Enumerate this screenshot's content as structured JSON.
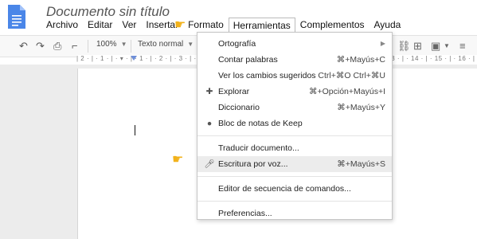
{
  "header": {
    "title": "Documento sin título",
    "menus": [
      "Archivo",
      "Editar",
      "Ver",
      "Insertar",
      "Formato",
      "Herramientas",
      "Complementos",
      "Ayuda"
    ]
  },
  "toolbar": {
    "zoom": "100%",
    "style": "Texto normal"
  },
  "ruler": {
    "text": "| 2 · | · 1 · | · ▾ · | · 1 · | · 2 · | · 3 · | · 4 · | · 5 · | · 6 · | · 7 · | · 8 · | · 9 · | · 10 · | · 11 · | · 12 · | · 13 · | · 14 · | · 15 · | · 16 · | · 17"
  },
  "menu": {
    "items": [
      {
        "label": "Ortografía",
        "shortcut": "",
        "submenu": true
      },
      {
        "label": "Contar palabras",
        "shortcut": "⌘+Mayús+C"
      },
      {
        "label": "Ver los cambios sugeridos",
        "shortcut": "Ctrl+⌘O Ctrl+⌘U"
      },
      {
        "label": "Explorar",
        "shortcut": "⌘+Opción+Mayús+I",
        "icon": "explore-icon"
      },
      {
        "label": "Diccionario",
        "shortcut": "⌘+Mayús+Y"
      },
      {
        "label": "Bloc de notas de Keep",
        "shortcut": "",
        "icon": "keep-bulb-icon"
      },
      {
        "label": "Traducir documento...",
        "shortcut": ""
      },
      {
        "label": "Escritura por voz...",
        "shortcut": "⌘+Mayús+S",
        "icon": "microphone-icon"
      },
      {
        "label": "Editor de secuencia de comandos...",
        "shortcut": ""
      },
      {
        "label": "Preferencias...",
        "shortcut": ""
      }
    ]
  }
}
